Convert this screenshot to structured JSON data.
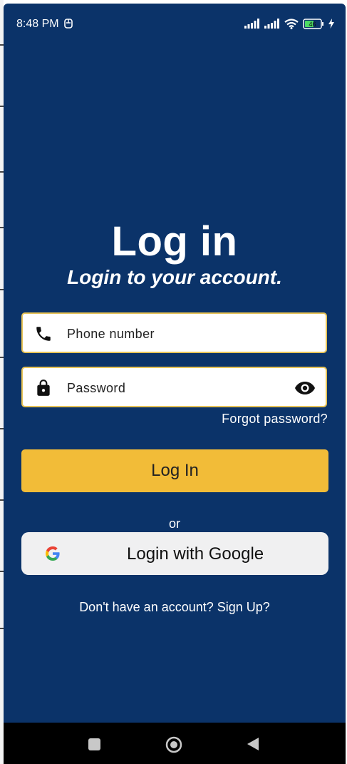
{
  "status_bar": {
    "time": "8:48 PM",
    "battery_level": "46",
    "icons": [
      "notification-icon",
      "signal-icon",
      "signal-icon",
      "wifi-icon",
      "battery-icon",
      "charging-icon"
    ]
  },
  "login": {
    "title": "Log in",
    "subtitle": "Login to your account.",
    "phone_placeholder": "Phone number",
    "password_placeholder": "Password",
    "forgot_password": "Forgot password?",
    "login_button": "Log In",
    "or_text": "or",
    "google_button": "Login with Google",
    "signup_prompt": "Don't have an account? Sign Up?"
  },
  "nav_bar": {
    "icons": [
      "recents-icon",
      "home-icon",
      "back-icon"
    ]
  },
  "colors": {
    "background": "#0b3369",
    "accent": "#f2bc38",
    "field_border": "#e7c357",
    "google_button_bg": "#f0f0f1"
  }
}
